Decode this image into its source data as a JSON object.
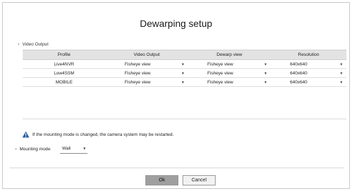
{
  "dialog": {
    "title": "Dewarping setup",
    "section_label": "Video Output",
    "columns": [
      "Profile",
      "Video Output",
      "Dewarp view",
      "Resolution"
    ],
    "rows": [
      {
        "profile": "Live4NVR",
        "video_output": "Fisheye view",
        "dewarp_view": "Fisheye view",
        "resolution": "640x640"
      },
      {
        "profile": "Low4SSM",
        "video_output": "Fisheye view",
        "dewarp_view": "Fisheye view",
        "resolution": "640x640"
      },
      {
        "profile": "MOBILE",
        "video_output": "Fisheye view",
        "dewarp_view": "Fisheye view",
        "resolution": "640x640"
      }
    ],
    "warning_text": "If the mounting mode is changed, the camera system may be restarted.",
    "mounting_mode_label": "Mounting mode",
    "mounting_mode_value": "Wall",
    "ok_label": "Ok",
    "cancel_label": "Cancel"
  },
  "icons": {
    "warning": "warning-triangle-icon",
    "dropdown": "chevron-down-icon",
    "bullet": "bullet-icon"
  },
  "colors": {
    "header_bg": "#e3e3e3",
    "ok_button_bg": "#9f9f9f",
    "cancel_button_bg": "#f2f2f2",
    "warning_icon": "#2b5fa8"
  }
}
